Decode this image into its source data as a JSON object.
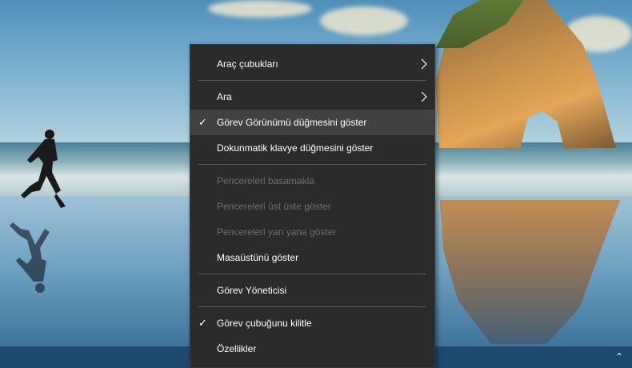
{
  "context_menu": {
    "items": [
      {
        "label": "Araç çubukları",
        "has_submenu": true
      },
      {
        "label": "Ara",
        "has_submenu": true
      },
      {
        "label": "Görev Görünümü düğmesini göster",
        "checked": true
      },
      {
        "label": "Dokunmatik klavye düğmesini göster"
      },
      {
        "label": "Pencereleri basamakla",
        "disabled": true
      },
      {
        "label": "Pencereleri üst üste göster",
        "disabled": true
      },
      {
        "label": "Pencereleri yan yana göster",
        "disabled": true
      },
      {
        "label": "Masaüstünü göster"
      },
      {
        "label": "Görev Yöneticisi"
      },
      {
        "label": "Görev çubuğunu kilitle",
        "checked": true
      },
      {
        "label": "Özellikler"
      }
    ]
  },
  "icons": {
    "checkmark": "checkmark-icon",
    "submenu": "chevron-right-icon",
    "tray": "chevron-up-icon"
  },
  "colors": {
    "menu_background": "#2b2b2b",
    "menu_hover": "#414141",
    "disabled_text": "#6d6d6d",
    "taskbar": "#1f4a70"
  },
  "glyphs": {
    "check": "✓",
    "tray_up": "⌃"
  }
}
